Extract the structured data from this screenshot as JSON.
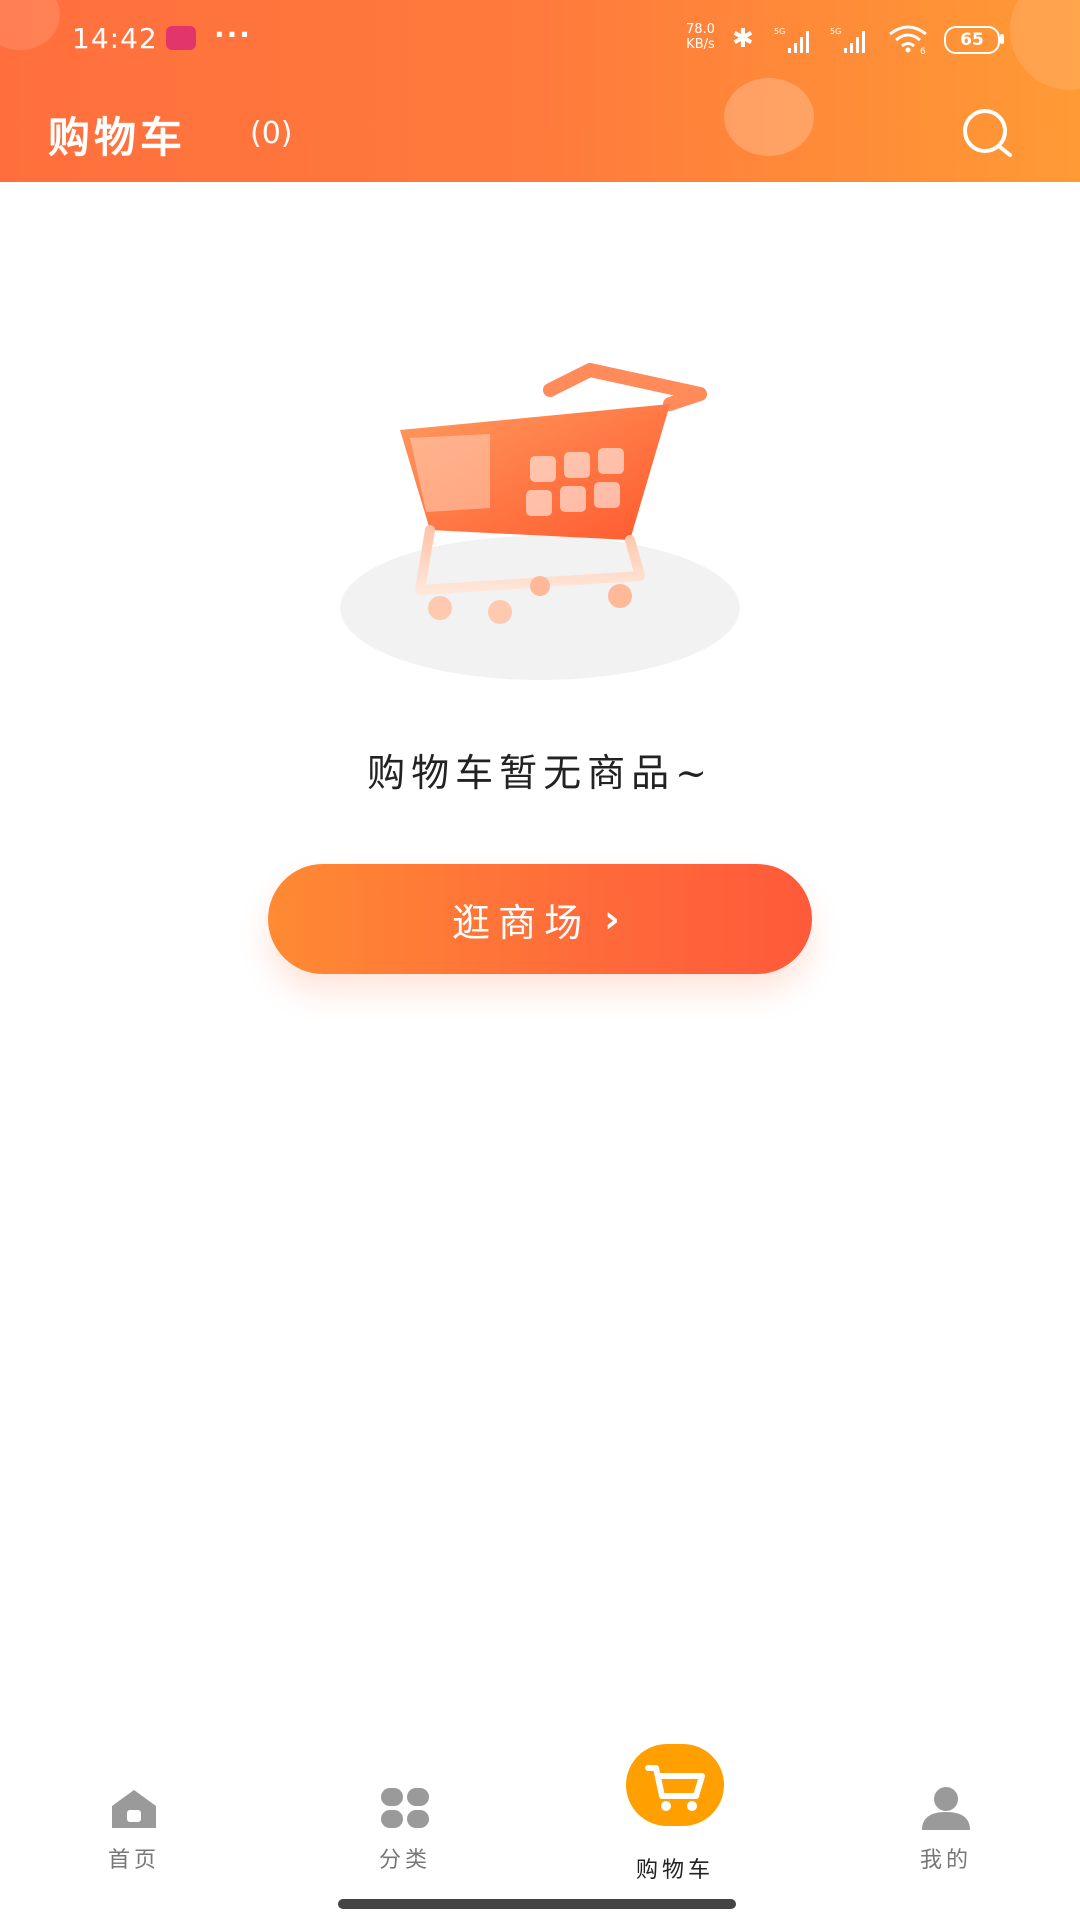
{
  "status_bar": {
    "time": "14:42",
    "more": "···",
    "net_speed_value": "78.0",
    "net_speed_unit": "KB/s",
    "bluetooth_icon": "bluetooth-icon",
    "signal_label_1": "5G",
    "signal_label_2": "5G",
    "wifi_label": "6",
    "battery": "65"
  },
  "header": {
    "title": "购物车",
    "count": "(0)",
    "search_icon": "search-icon"
  },
  "empty_state": {
    "illustration": "shopping-cart-illustration",
    "message": "购物车暂无商品~",
    "button_label": "逛商场",
    "button_chevron": "›"
  },
  "tabbar": {
    "items": [
      {
        "label": "首页",
        "icon": "home-icon",
        "active": false
      },
      {
        "label": "分类",
        "icon": "category-grid-icon",
        "active": false
      },
      {
        "label": "购物车",
        "icon": "cart-icon",
        "active": true
      },
      {
        "label": "我的",
        "icon": "user-icon",
        "active": false
      }
    ]
  },
  "colors": {
    "header_gradient_start": "#ff6f3d",
    "header_gradient_end": "#ff9a35",
    "button_orange": "#ff7a36",
    "active_tab": "#ffa000",
    "inactive_tab": "#8a8a8a"
  }
}
